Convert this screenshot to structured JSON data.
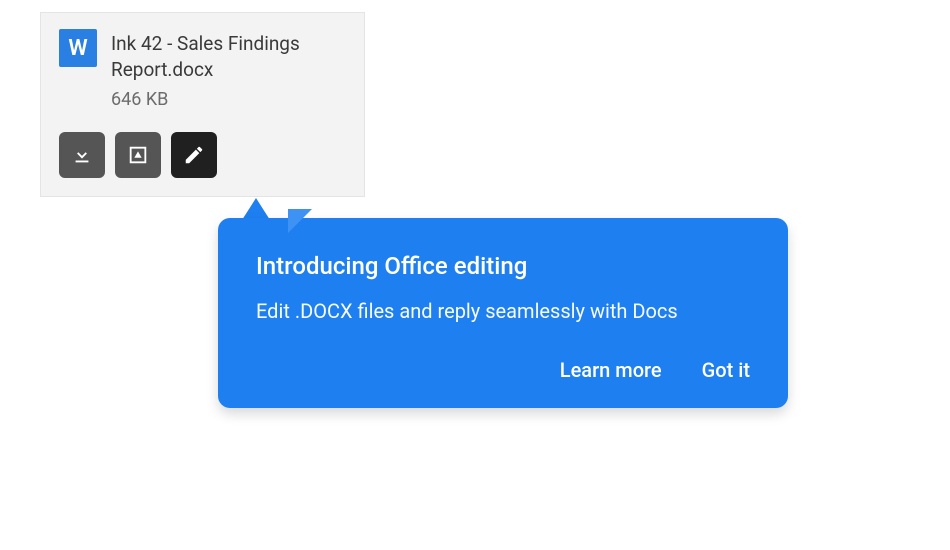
{
  "attachment": {
    "badge_letter": "W",
    "filename": "Ink 42 - Sales Findings Report.docx",
    "filesize": "646 KB",
    "icons": {
      "download": "download-icon",
      "save_drive": "save-to-drive-icon",
      "edit": "pencil-icon"
    }
  },
  "tooltip": {
    "title": "Introducing Office editing",
    "body": "Edit .DOCX files and reply seamlessly with Docs",
    "learn_more": "Learn more",
    "got_it": "Got it"
  },
  "colors": {
    "accent_blue": "#1e7ff0",
    "badge_blue": "#2a7fe2",
    "card_bg": "#f3f3f3",
    "btn_bg": "#555555",
    "btn_bg_active": "#202020"
  }
}
